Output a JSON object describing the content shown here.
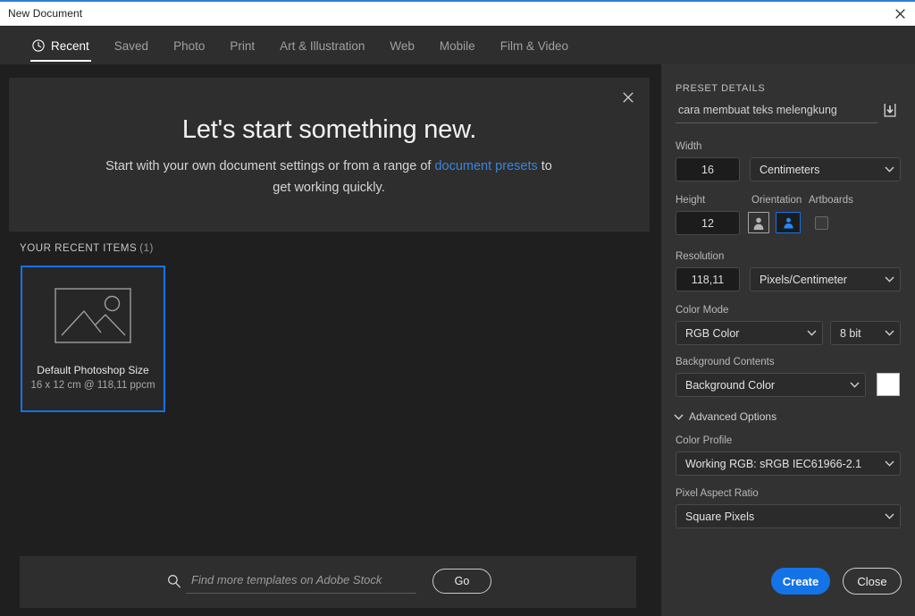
{
  "window": {
    "title": "New Document",
    "close_icon": "close-icon",
    "accent_color": "#2f7fd4"
  },
  "tabs": [
    {
      "label": "Recent",
      "icon": "clock-icon",
      "active": true
    },
    {
      "label": "Saved",
      "active": false
    },
    {
      "label": "Photo",
      "active": false
    },
    {
      "label": "Print",
      "active": false
    },
    {
      "label": "Art & Illustration",
      "active": false
    },
    {
      "label": "Web",
      "active": false
    },
    {
      "label": "Mobile",
      "active": false
    },
    {
      "label": "Film & Video",
      "active": false
    }
  ],
  "hero": {
    "title": "Let's start something new.",
    "body_before": "Start with your own document settings or from a range of ",
    "link": "document presets",
    "body_after": " to get working quickly.",
    "link_color": "#3b84dd",
    "close_icon": "close-icon"
  },
  "recent": {
    "heading": "YOUR RECENT ITEMS",
    "count": "(1)",
    "items": [
      {
        "title": "Default Photoshop Size",
        "meta": "16 x 12 cm @ 118,11 ppcm",
        "thumb_icon": "image-placeholder-icon",
        "selected": true,
        "selection_color": "#1473e6"
      }
    ]
  },
  "stock_search": {
    "icon": "search-icon",
    "value": "",
    "placeholder": "Find more templates on Adobe Stock",
    "go_label": "Go"
  },
  "preset_details": {
    "heading": "PRESET DETAILS",
    "preset_name": {
      "value": "cara membuat teks melengkung",
      "placeholder": "Untitled-1",
      "save_icon": "save-preset-icon"
    },
    "width": {
      "label": "Width",
      "value": "16",
      "unit": "Centimeters",
      "unit_chevron": "chevron-down-icon"
    },
    "height": {
      "label": "Height",
      "value": "12"
    },
    "orientation": {
      "label": "Orientation",
      "portrait_icon": "portrait-orientation-icon",
      "landscape_icon": "landscape-orientation-icon",
      "selected": "landscape"
    },
    "artboards": {
      "label": "Artboards",
      "checked": false
    },
    "resolution": {
      "label": "Resolution",
      "value": "118,11",
      "unit": "Pixels/Centimeter",
      "unit_chevron": "chevron-down-icon"
    },
    "color_mode": {
      "label": "Color Mode",
      "value": "RGB Color",
      "depth": "8 bit"
    },
    "background_contents": {
      "label": "Background Contents",
      "value": "Background Color",
      "swatch_color": "#ffffff"
    },
    "advanced": {
      "label": "Advanced Options",
      "chevron": "chevron-down-icon",
      "expanded": true,
      "color_profile": {
        "label": "Color Profile",
        "value": "Working RGB: sRGB IEC61966-2.1"
      },
      "pixel_aspect_ratio": {
        "label": "Pixel Aspect Ratio",
        "value": "Square Pixels"
      }
    }
  },
  "footer": {
    "create_label": "Create",
    "close_label": "Close",
    "create_color": "#1473e6"
  }
}
